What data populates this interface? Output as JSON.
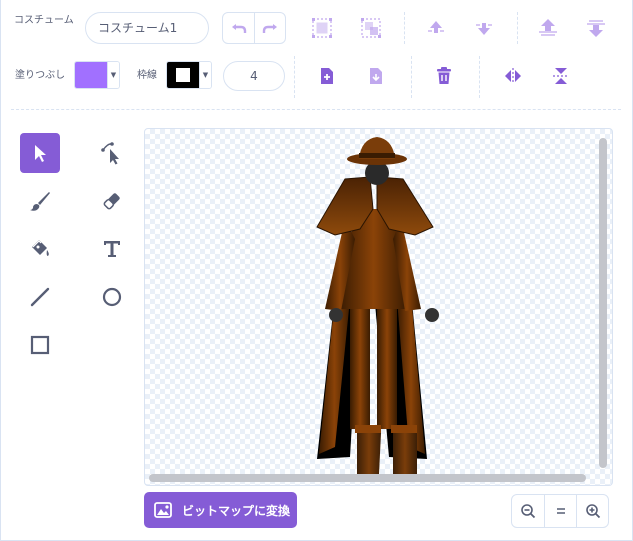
{
  "costume": {
    "label": "コスチューム",
    "name_value": "コスチューム1"
  },
  "fill": {
    "label": "塗りつぶし",
    "color": "#a170ff"
  },
  "outline": {
    "label": "枠線",
    "color": "#000000",
    "width_value": "4"
  },
  "toolbar_icons": [
    "undo-icon",
    "redo-icon",
    "group-icon",
    "ungroup-icon",
    "forward-icon",
    "backward-icon",
    "front-icon",
    "back-icon",
    "copy-icon",
    "paste-icon",
    "delete-icon",
    "flip-horizontal-icon",
    "flip-vertical-icon"
  ],
  "tools": [
    "select-tool",
    "reshape-tool",
    "brush-tool",
    "eraser-tool",
    "fill-tool",
    "text-tool",
    "line-tool",
    "circle-tool",
    "rectangle-tool"
  ],
  "convert_button": {
    "label": "ビットマップに変換"
  },
  "zoom": {
    "out_icon": "zoom-out-icon",
    "reset_icon": "zoom-reset-icon",
    "in_icon": "zoom-in-icon"
  },
  "colors": {
    "accent": "#855cd6",
    "icon_blue": "#855cd6"
  }
}
